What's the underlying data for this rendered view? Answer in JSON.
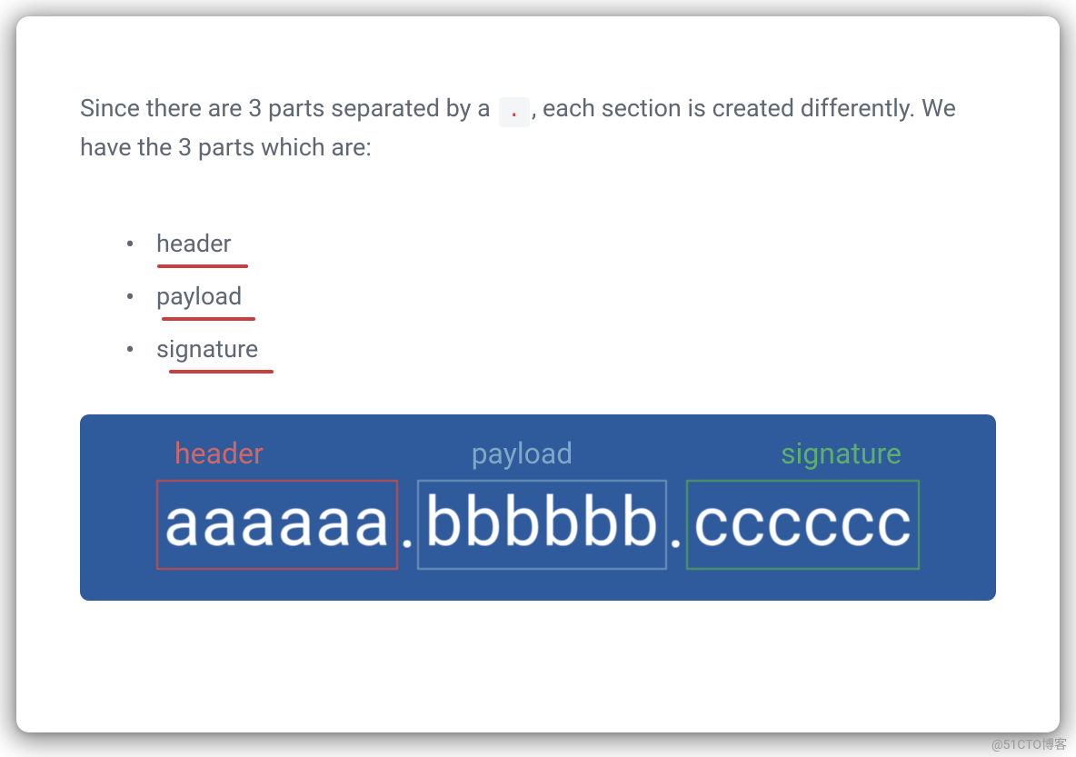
{
  "intro": {
    "before": "Since there are 3 parts separated by a ",
    "code": ".",
    "after": ", each section is created differently. We have the 3 parts which are:"
  },
  "parts": [
    "header",
    "payload",
    "signature"
  ],
  "diagram": {
    "labels": {
      "header": "header",
      "payload": "payload",
      "signature": "signature"
    },
    "segments": {
      "a": "aaaaaa",
      "b": "bbbbbb",
      "c": "cccccc"
    },
    "separator": "."
  },
  "watermark": "@51CTO博客",
  "colors": {
    "diagram_bg": "#2f5a9c",
    "header_color": "#d16666",
    "payload_color": "#7fa8c4",
    "signature_color": "#5cae6d",
    "annotation_underline": "#c73f3f"
  }
}
